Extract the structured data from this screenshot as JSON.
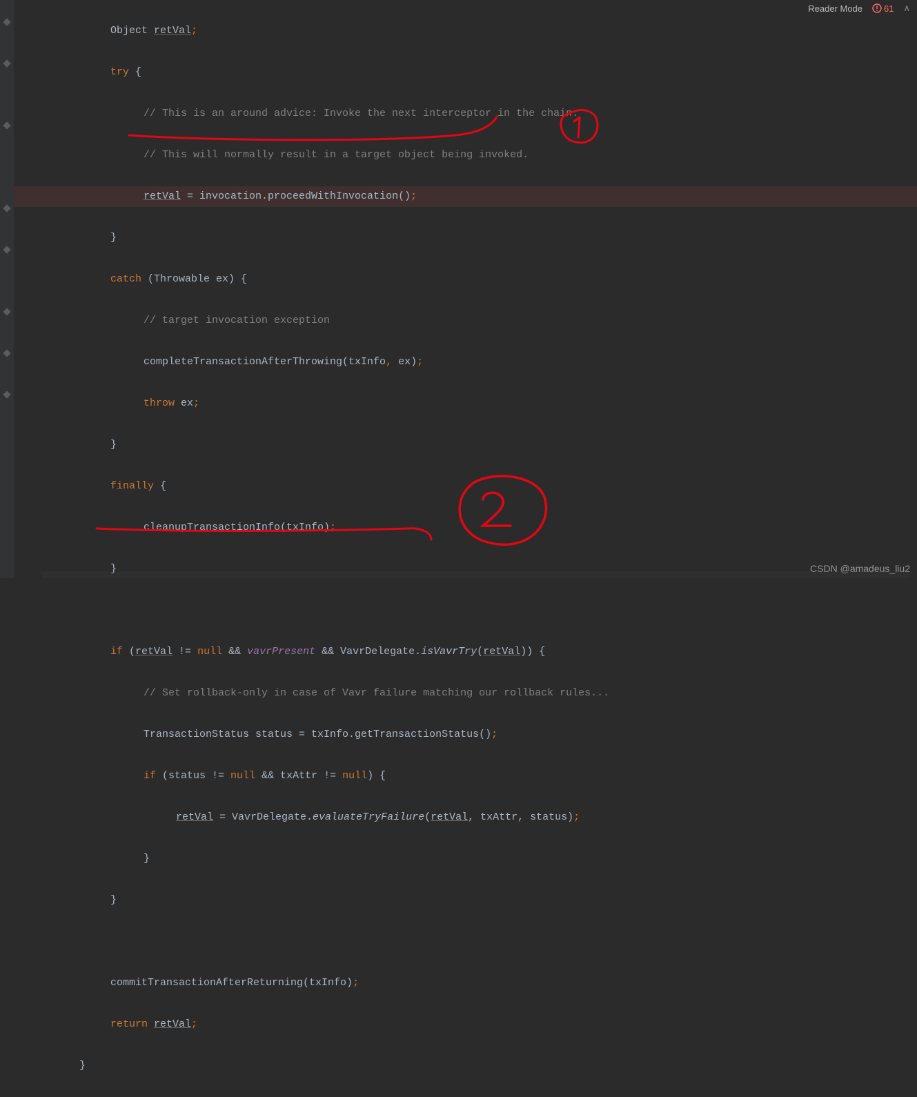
{
  "topbar": {
    "reader_mode": "Reader Mode",
    "error_count": "61"
  },
  "code": {
    "l1_p1": "Object ",
    "l1_var": "retVal",
    "l1_p2": ";",
    "l2_kw": "try",
    "l2_brace": " {",
    "l3_comment": "// This is an around advice: Invoke the next interceptor in the chain.",
    "l4_comment": "// This will normally result in a target object being invoked.",
    "l5_var": "retVal",
    "l5_rest": " = invocation.proceedWithInvocation()",
    "l5_semi": ";",
    "l6_brace": "}",
    "l7_kw": "catch",
    "l7_rest": " (Throwable ex) {",
    "l8_comment": "// target invocation exception",
    "l9_a": "completeTransactionAfterThrowing(txInfo",
    "l9_b": ", ",
    "l9_c": "ex)",
    "l9_semi": ";",
    "l10_kw": "throw",
    "l10_rest": " ex",
    "l10_semi": ";",
    "l11_brace": "}",
    "l12_kw": "finally",
    "l12_brace": " {",
    "l13_a": "cleanupTransactionInfo(txInfo)",
    "l13_semi": ";",
    "l14_brace": "}",
    "l16_kw_if": "if",
    "l16_p1": " (",
    "l16_var1": "retVal",
    "l16_p2": " != ",
    "l16_null1": "null",
    "l16_p3": " && ",
    "l16_vavr": "vavrPresent",
    "l16_p4": " && VavrDelegate.",
    "l16_isVavr": "isVavrTry",
    "l16_p5": "(",
    "l16_var2": "retVal",
    "l16_p6": ")) {",
    "l17_comment": "// Set rollback-only in case of Vavr failure matching our rollback rules...",
    "l18_a": "TransactionStatus status = txInfo.getTransactionStatus()",
    "l18_semi": ";",
    "l19_kw_if": "if",
    "l19_p1": " (status != ",
    "l19_null1": "null",
    "l19_p2": " && txAttr != ",
    "l19_null2": "null",
    "l19_p3": ") {",
    "l20_var": "retVal",
    "l20_p1": " = VavrDelegate.",
    "l20_eval": "evaluateTryFailure",
    "l20_p2": "(",
    "l20_var2": "retVal",
    "l20_p3": ", txAttr, status)",
    "l20_semi": ";",
    "l21_brace": "}",
    "l22_brace": "}",
    "l24_a": "commitTransactionAfterReturning(txInfo)",
    "l24_semi": ";",
    "l25_kw": "return",
    "l25_sp": " ",
    "l25_var": "retVal",
    "l25_semi": ";",
    "l26_brace": "}"
  },
  "watermark": "CSDN @amadeus_liu2"
}
